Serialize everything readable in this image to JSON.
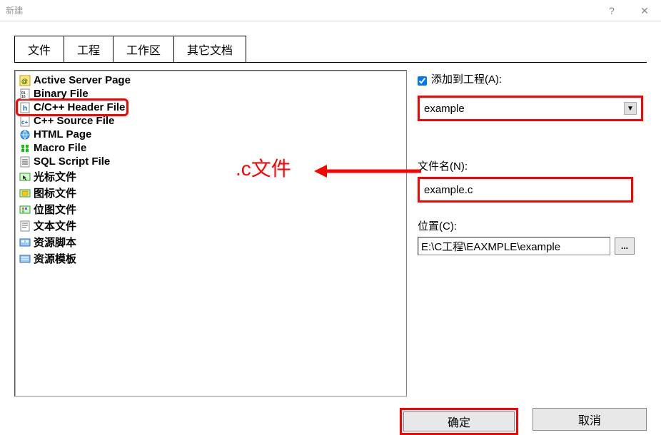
{
  "window": {
    "title": "新建"
  },
  "tabs": {
    "items": [
      {
        "label": "文件",
        "active": true
      },
      {
        "label": "工程",
        "active": false
      },
      {
        "label": "工作区",
        "active": false
      },
      {
        "label": "其它文档",
        "active": false
      }
    ]
  },
  "file_list": {
    "items": [
      {
        "label": "Active Server Page",
        "icon": "asp-icon",
        "highlighted": false
      },
      {
        "label": "Binary File",
        "icon": "binary-icon",
        "highlighted": false
      },
      {
        "label": "C/C++ Header File",
        "icon": "header-icon",
        "highlighted": true
      },
      {
        "label": "C++ Source File",
        "icon": "cpp-icon",
        "highlighted": false
      },
      {
        "label": "HTML Page",
        "icon": "html-icon",
        "highlighted": false
      },
      {
        "label": "Macro File",
        "icon": "macro-icon",
        "highlighted": false
      },
      {
        "label": "SQL Script File",
        "icon": "sql-icon",
        "highlighted": false
      },
      {
        "label": "光标文件",
        "icon": "cursor-icon",
        "highlighted": false
      },
      {
        "label": "图标文件",
        "icon": "icon-icon",
        "highlighted": false
      },
      {
        "label": "位图文件",
        "icon": "bitmap-icon",
        "highlighted": false
      },
      {
        "label": "文本文件",
        "icon": "text-icon",
        "highlighted": false
      },
      {
        "label": "资源脚本",
        "icon": "resource-icon",
        "highlighted": false
      },
      {
        "label": "资源模板",
        "icon": "template-icon",
        "highlighted": false
      }
    ]
  },
  "right": {
    "add_to_project_label": "添加到工程(A):",
    "add_to_project_checked": true,
    "project_name": "example",
    "filename_label": "文件名(N):",
    "filename_value": "example.c",
    "location_label": "位置(C):",
    "location_value": "E:\\C工程\\EAXMPLE\\example"
  },
  "buttons": {
    "ok": "确定",
    "cancel": "取消"
  },
  "annotation": {
    "text": ".c文件"
  }
}
